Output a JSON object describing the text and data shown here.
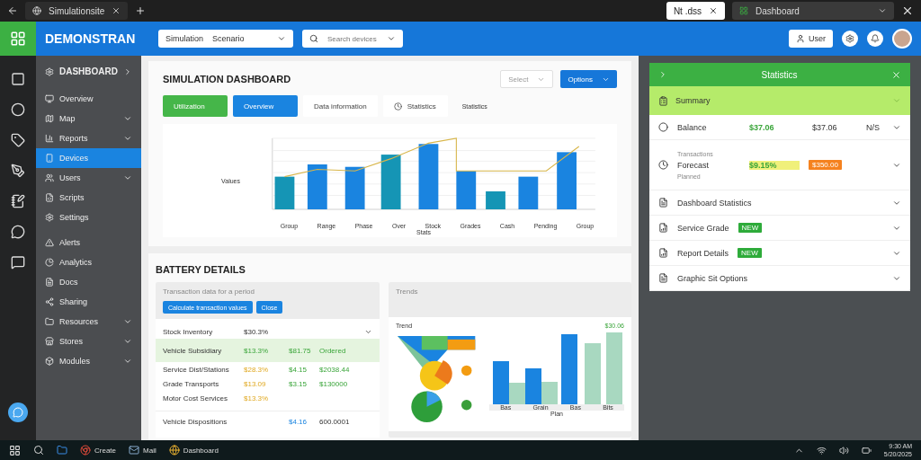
{
  "browser": {
    "tabs": [
      {
        "label": "Simulationsite",
        "kind": "dark"
      },
      {
        "label": "Nt .dss",
        "kind": "light"
      },
      {
        "label": "Dashboard",
        "kind": "grey"
      }
    ]
  },
  "header": {
    "logo": "DEMONSTRAN",
    "select_1": {
      "label": "Simulation",
      "value": "Scenario"
    },
    "search": {
      "placeholder": "Search devices"
    },
    "user_button": "User"
  },
  "sidebar": {
    "title": "DASHBOARD",
    "items": [
      {
        "label": "Overview",
        "expandable": false,
        "selected": false
      },
      {
        "label": "Map",
        "expandable": true,
        "selected": false
      },
      {
        "label": "Reports",
        "expandable": true,
        "selected": false
      },
      {
        "label": "Devices",
        "expandable": false,
        "selected": true
      },
      {
        "label": "Users",
        "expandable": true,
        "selected": false
      },
      {
        "label": "Scripts",
        "expandable": false,
        "selected": false
      },
      {
        "label": "Settings",
        "expandable": false,
        "selected": false
      },
      {
        "label": "Alerts",
        "expandable": false,
        "selected": false
      },
      {
        "label": "Analytics",
        "expandable": false,
        "selected": false
      },
      {
        "label": "Docs",
        "expandable": false,
        "selected": false
      },
      {
        "label": "Sharing",
        "expandable": false,
        "selected": false
      },
      {
        "label": "Resources",
        "expandable": true,
        "selected": false
      },
      {
        "label": "Stores",
        "expandable": true,
        "selected": false
      },
      {
        "label": "Modules",
        "expandable": true,
        "selected": false
      }
    ]
  },
  "overview": {
    "title": "SIMULATION DASHBOARD",
    "filter": "Select",
    "action": "Options",
    "tabs": [
      {
        "label": "Utilization",
        "kind": "green"
      },
      {
        "label": "Overview",
        "kind": "blue"
      },
      {
        "label": "Data information",
        "kind": "plain"
      },
      {
        "label": "Statistics",
        "kind": "plain"
      }
    ],
    "side_label": "Statistics",
    "ylabel": "Values",
    "xlabel": "Stats",
    "x_labels": [
      "Group",
      "Range",
      "Phase",
      "Over",
      "Stock",
      "Grades",
      "Cash",
      "Pending",
      "Group"
    ]
  },
  "details": {
    "title": "BATTERY DETAILS",
    "table_card": {
      "caption": "Transaction data for a period",
      "buttons": [
        "Calculate transaction values",
        "Close"
      ],
      "rows": [
        {
          "name": "Stock Inventory",
          "value": "$30.3%",
          "kind": "neutral",
          "selected": false
        },
        {
          "name": "Vehicle Subsidiary",
          "value": "$13.3%",
          "amount": "$81.75",
          "status": "Ordered",
          "kind": "positive",
          "selected": true
        },
        {
          "name": "Service Dist/Stations",
          "value": "$28.3%",
          "amount": "$4.15",
          "status": "$2038.44",
          "kind": "warning",
          "selected": false
        },
        {
          "name": "Grade Transports",
          "value": "$13.09",
          "amount": "$3.15",
          "status": "$130000",
          "kind": "warning",
          "selected": false
        },
        {
          "name": "Motor Cost Services",
          "value": "$13.3%",
          "kind": "warning",
          "selected": false
        }
      ],
      "footer": {
        "name": "Vehicle Dispositions",
        "amount": "$4.16",
        "status": "600.0001"
      }
    },
    "trend_card": {
      "caption": "Trends",
      "title": "Trend",
      "value": "$30.06",
      "x_labels": [
        "Bas",
        "Grain",
        "Bas",
        "Bits"
      ],
      "xlabel": "Plan"
    }
  },
  "stats_panel": {
    "title": "Statistics",
    "summary": "Summary",
    "rows": [
      {
        "kind": "values",
        "label": "Balance",
        "value": "$37.06",
        "amount": "$37.06",
        "note": "N/S"
      },
      {
        "kind": "badges",
        "over": "Transactions",
        "label": "Forecast",
        "value": "$9.15%",
        "amount": "$350.00",
        "under": "Planned"
      },
      {
        "kind": "plain",
        "label": "Dashboard Statistics"
      },
      {
        "kind": "tag",
        "label": "Service Grade",
        "tag": "NEW"
      },
      {
        "kind": "tag",
        "label": "Report Details",
        "tag": "NEW"
      },
      {
        "kind": "plain",
        "label": "Graphic Sit Options"
      }
    ]
  },
  "taskbar": {
    "apps": [
      {
        "label": "Create",
        "kind": "labeled"
      },
      {
        "label": "Mail",
        "kind": "labeled"
      },
      {
        "label": "Dashboard",
        "kind": "labeled"
      }
    ],
    "time": "9:30 AM",
    "date": "5/20/2025"
  }
}
